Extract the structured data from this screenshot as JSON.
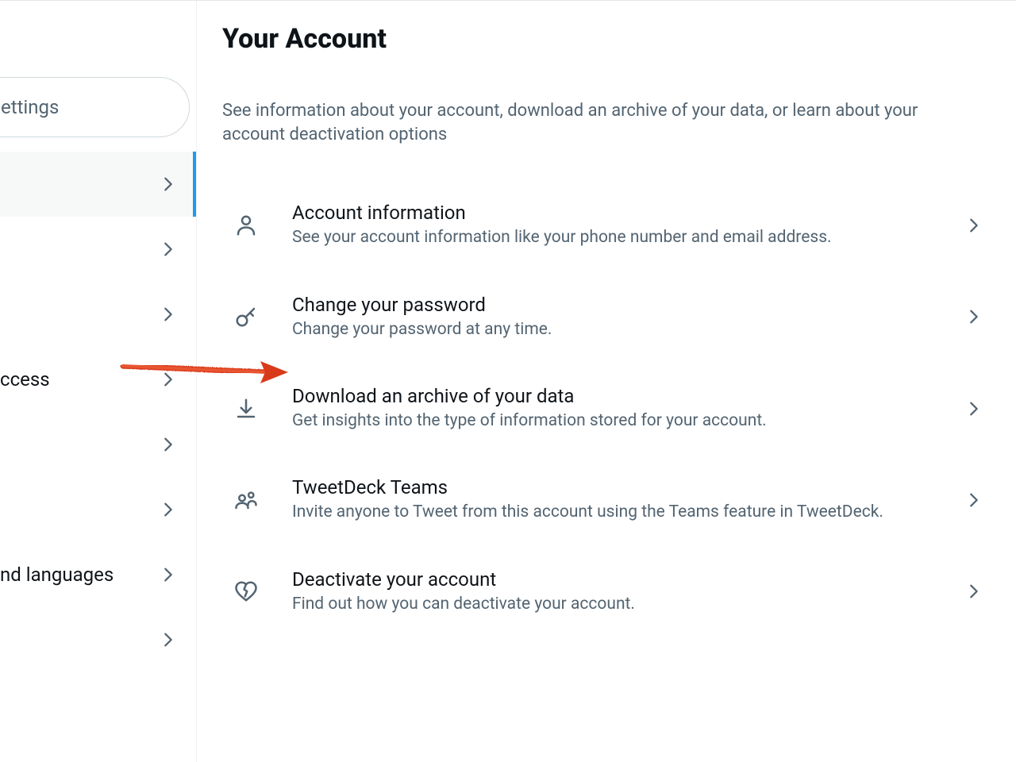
{
  "sidebar": {
    "search_placeholder": "ettings",
    "items": [
      {
        "label": "",
        "selected": true
      },
      {
        "label": ""
      },
      {
        "label": ""
      },
      {
        "label": "ccess"
      },
      {
        "label": ""
      },
      {
        "label": ""
      },
      {
        "label": "nd languages"
      },
      {
        "label": ""
      }
    ]
  },
  "main": {
    "title": "Your Account",
    "description": "See information about your account, download an archive of your data, or learn about your account deactivation options",
    "options": [
      {
        "icon": "person",
        "title": "Account information",
        "desc": "See your account information like your phone number and email address."
      },
      {
        "icon": "key",
        "title": "Change your password",
        "desc": "Change your password at any time."
      },
      {
        "icon": "download",
        "title": "Download an archive of your data",
        "desc": "Get insights into the type of information stored for your account."
      },
      {
        "icon": "people",
        "title": "TweetDeck Teams",
        "desc": "Invite anyone to Tweet from this account using the Teams feature in TweetDeck."
      },
      {
        "icon": "heart-broken",
        "title": "Deactivate your account",
        "desc": "Find out how you can deactivate your account."
      }
    ]
  }
}
